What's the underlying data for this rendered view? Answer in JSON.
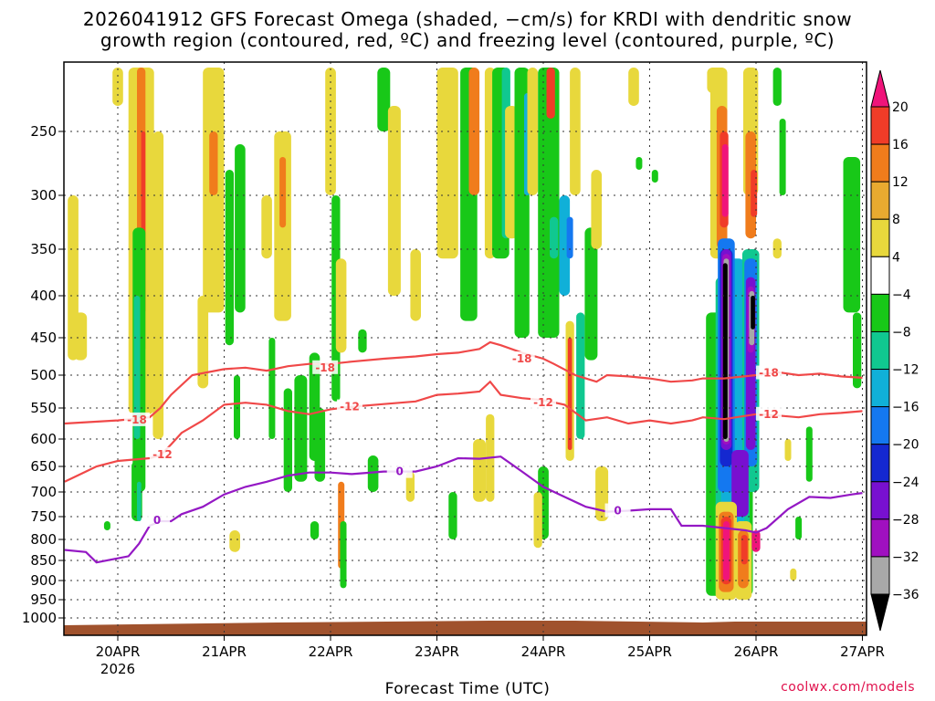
{
  "page": {
    "title_line1": "2026041912 GFS Forecast Omega (shaded, −cm/s) for KRDI with dendritic snow",
    "title_line2": "growth region (contoured, red, ºC) and freezing level (contoured, purple, ºC)",
    "credit": "coolwx.com/models"
  },
  "chart_data": {
    "type": "heatmap",
    "xlabel": "Forecast Time (UTC)",
    "ylabel": "",
    "xlim": [
      -0.5,
      7.0
    ],
    "ylim": [
      1050,
      200
    ],
    "x_ticks": [
      {
        "x": 0,
        "label": "20APR",
        "sublabel": "2026"
      },
      {
        "x": 1,
        "label": "21APR"
      },
      {
        "x": 2,
        "label": "22APR"
      },
      {
        "x": 3,
        "label": "23APR"
      },
      {
        "x": 4,
        "label": "24APR"
      },
      {
        "x": 5,
        "label": "25APR"
      },
      {
        "x": 6,
        "label": "26APR"
      },
      {
        "x": 7,
        "label": "27APR"
      }
    ],
    "y_ticks": [
      250,
      300,
      350,
      400,
      450,
      500,
      550,
      600,
      650,
      700,
      750,
      800,
      850,
      900,
      950,
      1000
    ],
    "grid": true,
    "colorbar": {
      "labels": [
        "20",
        "16",
        "12",
        "8",
        "4",
        "−4",
        "−8",
        "−12",
        "−16",
        "−20",
        "−24",
        "−28",
        "−32",
        "−36"
      ],
      "colors": [
        "#f0147a",
        "#f03c28",
        "#f07c1c",
        "#e8aa30",
        "#e8d83c",
        "#ffffff",
        "#18c818",
        "#10c890",
        "#10b0d8",
        "#1478f0",
        "#1428d0",
        "#7810d0",
        "#a010c0",
        "#a8a8a8",
        "#000000"
      ],
      "top_color": "#f0147a",
      "bottom_color": "#000000"
    },
    "ground_color": "#a0522d",
    "contours": [
      {
        "name": "-18",
        "color": "#f04848",
        "points": [
          [
            -0.5,
            575
          ],
          [
            0,
            570
          ],
          [
            0.3,
            565
          ],
          [
            0.4,
            550
          ],
          [
            0.5,
            530
          ],
          [
            0.7,
            500
          ],
          [
            1,
            492
          ],
          [
            1.2,
            490
          ],
          [
            1.4,
            494
          ],
          [
            1.6,
            488
          ],
          [
            1.8,
            485
          ],
          [
            2,
            485
          ],
          [
            2.2,
            482
          ],
          [
            2.5,
            478
          ],
          [
            2.8,
            475
          ],
          [
            3,
            472
          ],
          [
            3.2,
            470
          ],
          [
            3.4,
            465
          ],
          [
            3.5,
            456
          ],
          [
            3.6,
            460
          ],
          [
            3.8,
            470
          ],
          [
            4,
            478
          ],
          [
            4.1,
            485
          ],
          [
            4.3,
            500
          ],
          [
            4.5,
            510
          ],
          [
            4.6,
            500
          ],
          [
            4.8,
            502
          ],
          [
            5,
            505
          ],
          [
            5.2,
            510
          ],
          [
            5.4,
            508
          ],
          [
            5.5,
            505
          ],
          [
            5.7,
            505
          ],
          [
            6,
            500
          ],
          [
            6.2,
            496
          ],
          [
            6.4,
            500
          ],
          [
            6.6,
            498
          ],
          [
            6.8,
            502
          ],
          [
            7,
            504
          ]
        ],
        "labels": [
          [
            0.18,
            569
          ],
          [
            1.95,
            490
          ],
          [
            3.8,
            478
          ],
          [
            6.12,
            497
          ]
        ]
      },
      {
        "name": "-12",
        "color": "#f04848",
        "points": [
          [
            -0.5,
            680
          ],
          [
            -0.3,
            660
          ],
          [
            -0.2,
            650
          ],
          [
            0,
            640
          ],
          [
            0.3,
            635
          ],
          [
            0.4,
            630
          ],
          [
            0.5,
            610
          ],
          [
            0.6,
            590
          ],
          [
            0.8,
            570
          ],
          [
            1,
            545
          ],
          [
            1.2,
            542
          ],
          [
            1.4,
            545
          ],
          [
            1.6,
            555
          ],
          [
            1.8,
            560
          ],
          [
            2,
            552
          ],
          [
            2.2,
            548
          ],
          [
            2.5,
            544
          ],
          [
            2.8,
            540
          ],
          [
            3,
            530
          ],
          [
            3.2,
            528
          ],
          [
            3.4,
            525
          ],
          [
            3.5,
            510
          ],
          [
            3.6,
            530
          ],
          [
            3.8,
            535
          ],
          [
            4,
            538
          ],
          [
            4.2,
            545
          ],
          [
            4.4,
            570
          ],
          [
            4.6,
            565
          ],
          [
            4.8,
            575
          ],
          [
            5,
            570
          ],
          [
            5.2,
            575
          ],
          [
            5.4,
            570
          ],
          [
            5.5,
            565
          ],
          [
            5.7,
            568
          ],
          [
            6,
            560
          ],
          [
            6.2,
            562
          ],
          [
            6.4,
            565
          ],
          [
            6.6,
            560
          ],
          [
            6.8,
            558
          ],
          [
            7,
            555
          ]
        ],
        "labels": [
          [
            0.42,
            628
          ],
          [
            2.18,
            548
          ],
          [
            4.0,
            542
          ],
          [
            6.12,
            560
          ]
        ]
      },
      {
        "name": "0",
        "color": "#9418c4",
        "points": [
          [
            -0.5,
            825
          ],
          [
            -0.3,
            830
          ],
          [
            -0.2,
            855
          ],
          [
            0,
            845
          ],
          [
            0.1,
            840
          ],
          [
            0.2,
            810
          ],
          [
            0.3,
            770
          ],
          [
            0.4,
            760
          ],
          [
            0.5,
            760
          ],
          [
            0.6,
            745
          ],
          [
            0.8,
            730
          ],
          [
            1,
            705
          ],
          [
            1.2,
            690
          ],
          [
            1.4,
            680
          ],
          [
            1.6,
            668
          ],
          [
            1.8,
            662
          ],
          [
            2,
            662
          ],
          [
            2.2,
            665
          ],
          [
            2.5,
            660
          ],
          [
            2.8,
            660
          ],
          [
            3,
            650
          ],
          [
            3.2,
            635
          ],
          [
            3.4,
            636
          ],
          [
            3.6,
            632
          ],
          [
            3.8,
            660
          ],
          [
            4,
            690
          ],
          [
            4.2,
            710
          ],
          [
            4.4,
            730
          ],
          [
            4.6,
            740
          ],
          [
            4.8,
            738
          ],
          [
            5,
            735
          ],
          [
            5.2,
            735
          ],
          [
            5.3,
            770
          ],
          [
            5.5,
            770
          ],
          [
            5.7,
            775
          ],
          [
            5.9,
            780
          ],
          [
            6,
            785
          ],
          [
            6.1,
            775
          ],
          [
            6.3,
            735
          ],
          [
            6.5,
            710
          ],
          [
            6.7,
            712
          ],
          [
            6.9,
            705
          ],
          [
            7,
            702
          ]
        ],
        "labels": [
          [
            0.37,
            758
          ],
          [
            2.65,
            660
          ],
          [
            4.7,
            738
          ]
        ]
      }
    ]
  }
}
